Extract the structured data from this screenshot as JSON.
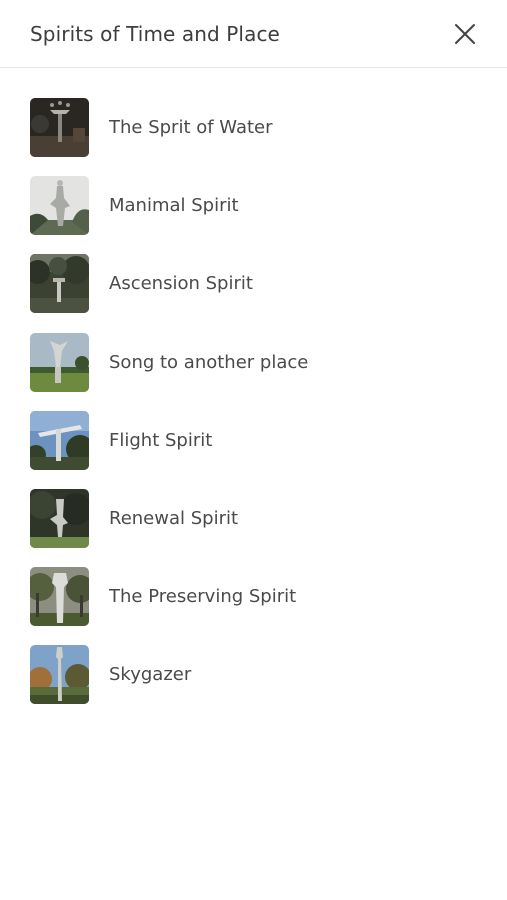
{
  "header": {
    "title": "Spirits of Time and Place",
    "close_icon": "close-icon"
  },
  "items": [
    {
      "label": "The Sprit of Water",
      "thumb_icon": "sculpture-photo-thumbnail"
    },
    {
      "label": "Manimal Spirit",
      "thumb_icon": "sculpture-photo-thumbnail"
    },
    {
      "label": "Ascension Spirit",
      "thumb_icon": "sculpture-photo-thumbnail"
    },
    {
      "label": "Song to another place",
      "thumb_icon": "sculpture-photo-thumbnail"
    },
    {
      "label": "Flight Spirit",
      "thumb_icon": "sculpture-photo-thumbnail"
    },
    {
      "label": "Renewal Spirit",
      "thumb_icon": "sculpture-photo-thumbnail"
    },
    {
      "label": "The Preserving Spirit",
      "thumb_icon": "sculpture-photo-thumbnail"
    },
    {
      "label": "Skygazer",
      "thumb_icon": "sculpture-photo-thumbnail"
    }
  ]
}
